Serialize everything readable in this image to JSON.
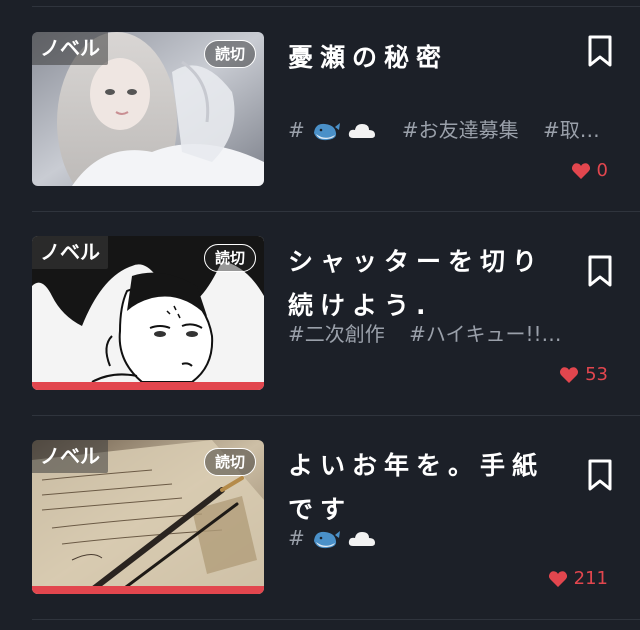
{
  "colors": {
    "background": "#1c2028",
    "accent": "#e2464e",
    "tag_text": "#9aa0aa",
    "divider": "#2f343d"
  },
  "cards": [
    {
      "type_label": "ノベル",
      "badge": "読切",
      "title": "憂瀬の秘密",
      "tags": [
        "#",
        "#お友達募集",
        "#取…"
      ],
      "first_tag_icons": [
        "whale-icon",
        "cloud-icon"
      ],
      "likes": "0",
      "has_progress_bar": false
    },
    {
      "type_label": "ノベル",
      "badge": "読切",
      "title": "シャッターを切り続けよう.",
      "tags": [
        "#二次創作",
        "#ハイキュー!!…"
      ],
      "first_tag_icons": [],
      "likes": "53",
      "has_progress_bar": true
    },
    {
      "type_label": "ノベル",
      "badge": "読切",
      "title": "よいお年を。手紙です",
      "tags": [
        "#"
      ],
      "first_tag_icons": [
        "whale-icon",
        "cloud-icon"
      ],
      "likes": "211",
      "has_progress_bar": true
    }
  ]
}
